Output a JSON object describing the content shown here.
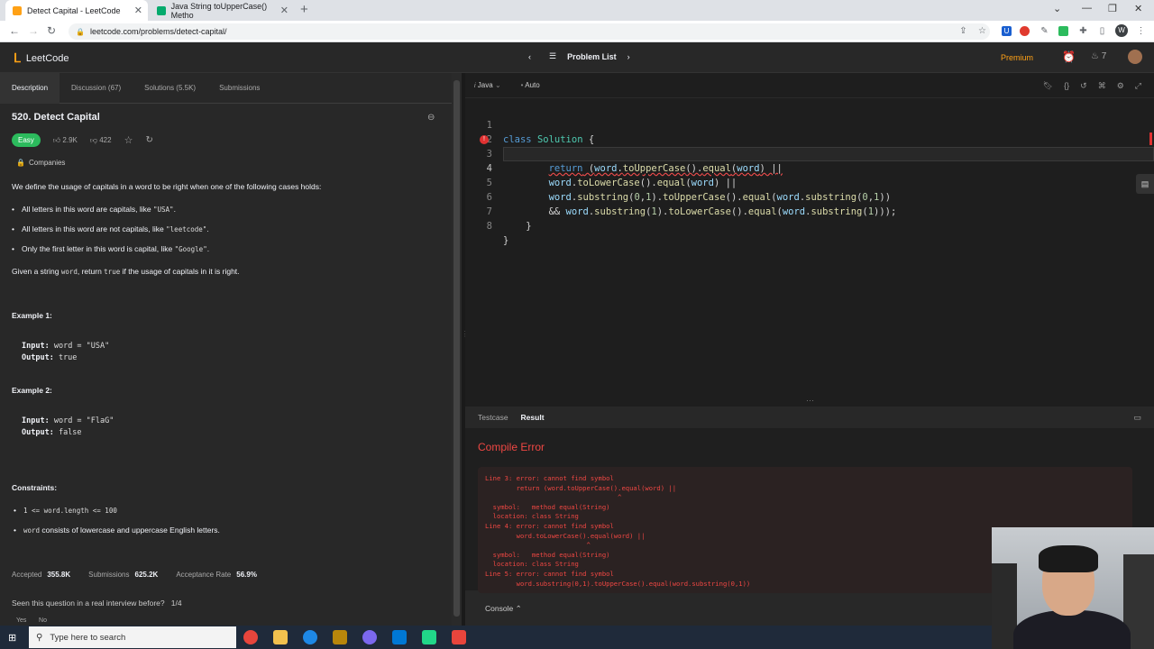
{
  "browser": {
    "tabs": [
      {
        "title": "Detect Capital - LeetCode",
        "close": "✕"
      },
      {
        "title": "Java String toUpperCase() Metho",
        "close": "✕"
      }
    ],
    "new_tab": "+",
    "url": "leetcode.com/problems/detect-capital/",
    "win_controls": [
      "⌄",
      "—",
      "❐",
      "✕"
    ],
    "nav": {
      "back": "←",
      "forward": "→",
      "reload": "↻"
    },
    "profile_letter": "W"
  },
  "lc_nav": {
    "brand": "LeetCode",
    "problem_list": "Problem List",
    "premium": "Premium",
    "streak": "7"
  },
  "left": {
    "tabs": [
      "Description",
      "Discussion (67)",
      "Solutions (5.5K)",
      "Submissions"
    ],
    "title": "520. Detect Capital",
    "difficulty": "Easy",
    "likes": "2.9K",
    "dislikes": "422",
    "companies": "Companies",
    "intro": "We define the usage of capitals in a word to be right when one of the following cases holds:",
    "cases": [
      {
        "text": "All letters in this word are capitals, like ",
        "code": "\"USA\"",
        "end": "."
      },
      {
        "text": "All letters in this word are not capitals, like ",
        "code": "\"leetcode\"",
        "end": "."
      },
      {
        "text": "Only the first letter in this word is capital, like ",
        "code": "\"Google\"",
        "end": "."
      }
    ],
    "given": {
      "a": "Given a string ",
      "c1": "word",
      "b": ", return ",
      "c2": "true",
      "d": " if the usage of capitals in it is right."
    },
    "examples": [
      {
        "heading": "Example 1:",
        "input_label": "Input:",
        "input": " word = \"USA\"",
        "output_label": "Output:",
        "output": " true"
      },
      {
        "heading": "Example 2:",
        "input_label": "Input:",
        "input": " word = \"FlaG\"",
        "output_label": "Output:",
        "output": " false"
      }
    ],
    "constraints_heading": "Constraints:",
    "constraints": [
      {
        "code": "1 <= word.length <= 100",
        "text": ""
      },
      {
        "code": "word",
        "text": " consists of lowercase and uppercase English letters."
      }
    ],
    "stats": [
      {
        "label": "Accepted",
        "value": "355.8K"
      },
      {
        "label": "Submissions",
        "value": "625.2K"
      },
      {
        "label": "Acceptance Rate",
        "value": "56.9%"
      }
    ],
    "seen": "Seen this question in a real interview before?",
    "seen_count": "1/4",
    "yes": "Yes",
    "no": "No"
  },
  "editor": {
    "language": "Java",
    "mode": "Auto",
    "lines": [
      {
        "n": "1"
      },
      {
        "n": "2"
      },
      {
        "n": "3"
      },
      {
        "n": "4"
      },
      {
        "n": "5"
      },
      {
        "n": "6"
      },
      {
        "n": "7"
      },
      {
        "n": "8"
      }
    ]
  },
  "result": {
    "tabs": [
      "Testcase",
      "Result"
    ],
    "status": "Compile Error",
    "error_text": "Line 3: error: cannot find symbol\n        return (word.toUpperCase().equal(word) ||\n                                  ^\n  symbol:   method equal(String)\n  location: class String\nLine 4: error: cannot find symbol\n        word.toLowerCase().equal(word) ||\n                          ^\n  symbol:   method equal(String)\n  location: class String\nLine 5: error: cannot find symbol\n        word.substring(0,1).toUpperCase().equal(word.substring(0,1))",
    "console": "Console"
  },
  "taskbar": {
    "search_placeholder": "Type here to search"
  },
  "colors": {
    "accent": "#ffa116",
    "easy": "#2cbb5d",
    "error": "#ef4743"
  }
}
